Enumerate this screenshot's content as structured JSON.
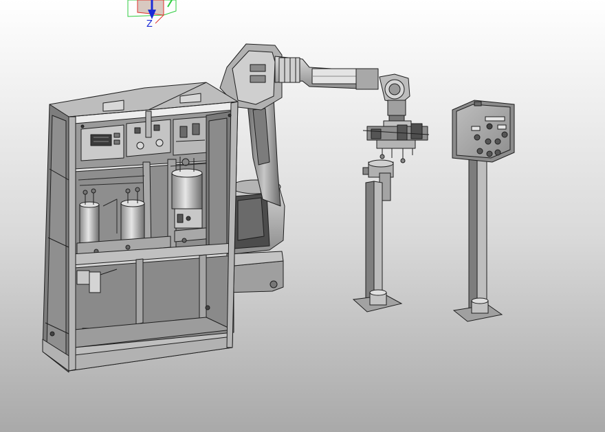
{
  "viewport": {
    "background_top": "#ffffff",
    "background_bottom": "#a9a9a9"
  },
  "triad": {
    "z_label": "Z",
    "x_color": "#e0302a",
    "y_color": "#2ecc40",
    "z_color": "#1a2ad6"
  },
  "colors": {
    "metal_light": "#c9c9c9",
    "metal_mid": "#9a9a9a",
    "metal_dark": "#5e5e5e",
    "edge": "#1e1e1e"
  }
}
